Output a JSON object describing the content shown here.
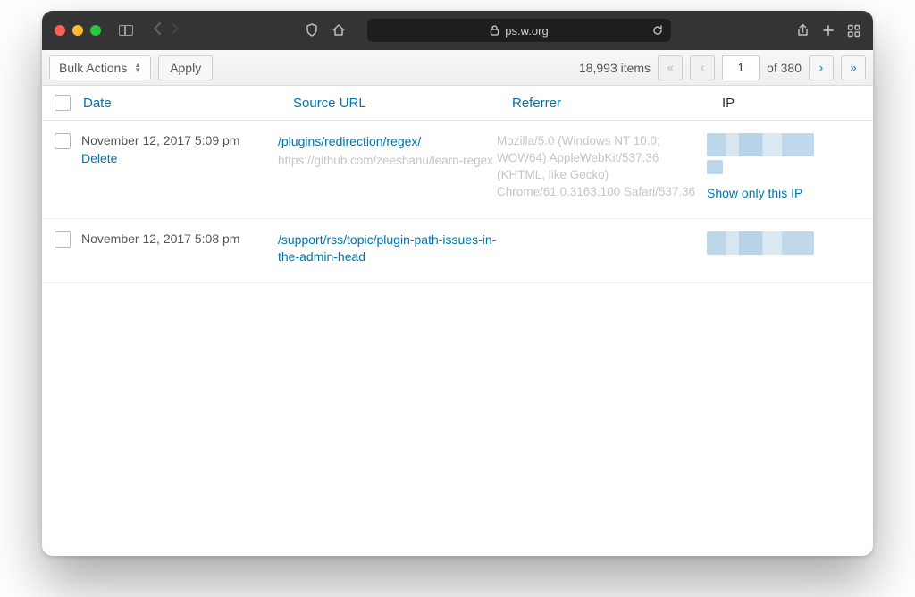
{
  "browser": {
    "address": "ps.w.org"
  },
  "toolbar": {
    "bulk_actions_label": "Bulk Actions",
    "apply_label": "Apply"
  },
  "pagination": {
    "items_text": "18,993 items",
    "first_glyph": "«",
    "prev_glyph": "‹",
    "current_page": "1",
    "of_text": "of 380",
    "next_glyph": "›",
    "last_glyph": "»"
  },
  "headers": {
    "date": "Date",
    "source_url": "Source URL",
    "referrer": "Referrer",
    "ip": "IP"
  },
  "rows": [
    {
      "date": "November 12, 2017 5:09 pm",
      "delete_label": "Delete",
      "source_url": "/plugins/redirection/regex/",
      "source_full": "https://github.com/zeeshanu/learn-regex",
      "referrer": "Mozilla/5.0 (Windows NT 10.0; WOW64) AppleWebKit/537.36 (KHTML, like Gecko) Chrome/61.0.3163.100 Safari/537.36",
      "show_ip_label": "Show only this IP"
    },
    {
      "date": "November 12, 2017 5:08 pm",
      "source_url": "/support/rss/topic/plugin-path-issues-in-the-admin-head"
    }
  ]
}
